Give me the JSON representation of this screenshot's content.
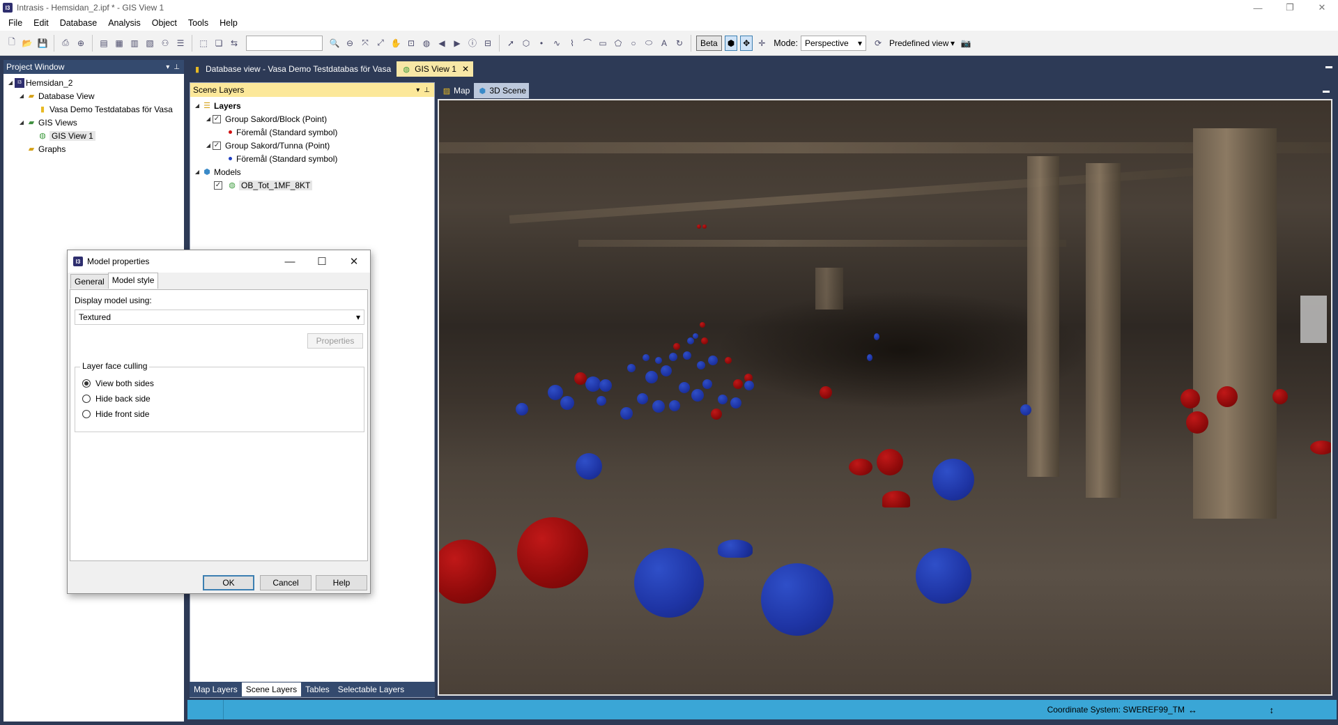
{
  "window": {
    "title": "Intrasis - Hemsidan_2.ipf * - GIS View 1",
    "logo": "I3"
  },
  "menu": [
    "File",
    "Edit",
    "Database",
    "Analysis",
    "Object",
    "Tools",
    "Help"
  ],
  "toolbar": {
    "beta_label": "Beta",
    "mode_label": "Mode:",
    "mode_value": "Perspective",
    "predefined_view": "Predefined view"
  },
  "project_window": {
    "title": "Project Window",
    "tree": {
      "root": "Hemsidan_2",
      "database_view": "Database View",
      "database_item": "Vasa Demo Testdatabas för Vasa",
      "gis_views": "GIS Views",
      "gis_view_item": "GIS View 1",
      "graphs": "Graphs"
    }
  },
  "doc_tabs": {
    "database_view": "Database view - Vasa Demo Testdatabas för Vasa",
    "gis_view": "GIS View 1"
  },
  "scene_layers": {
    "title": "Scene Layers",
    "layers_label": "Layers",
    "group1": "Group Sakord/Block (Point)",
    "group1_item": "Föremål (Standard symbol)",
    "group2": "Group Sakord/Tunna (Point)",
    "group2_item": "Föremål (Standard symbol)",
    "models_label": "Models",
    "model_item": "OB_Tot_1MF_8KT"
  },
  "bottom_tabs": [
    "Map Layers",
    "Scene Layers",
    "Tables",
    "Selectable Layers"
  ],
  "view_tabs": {
    "map": "Map",
    "scene": "3D Scene"
  },
  "status": {
    "coordinate_system": "Coordinate System: SWEREF99_TM"
  },
  "dialog": {
    "title": "Model properties",
    "tab_general": "General",
    "tab_model_style": "Model style",
    "display_label": "Display model using:",
    "display_value": "Textured",
    "properties_button": "Properties",
    "culling_title": "Layer face culling",
    "options": [
      "View both sides",
      "Hide back side",
      "Hide front side"
    ],
    "ok": "OK",
    "cancel": "Cancel",
    "help": "Help"
  },
  "colors": {
    "panel_header": "#344a6e",
    "active_tab": "#f7e7a6",
    "statusbar": "#3aa6d6",
    "sphere_red": "#a10e0e",
    "sphere_blue": "#1e34a4"
  }
}
